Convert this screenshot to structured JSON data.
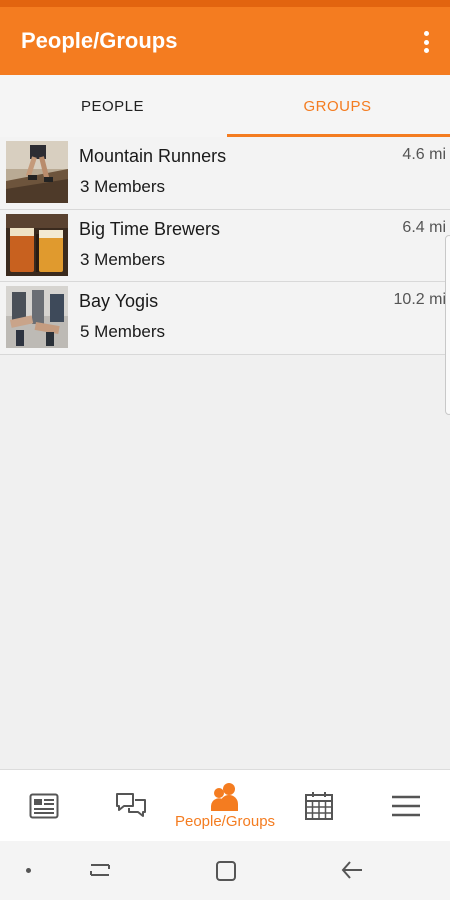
{
  "app_bar": {
    "title": "People/Groups",
    "menu_icon": "overflow-menu-icon"
  },
  "tabs": [
    {
      "label": "PEOPLE",
      "selected": false
    },
    {
      "label": "GROUPS",
      "selected": true
    }
  ],
  "groups": [
    {
      "name": "Mountain Runners",
      "members": "3 Members",
      "distance": "4.6 mi",
      "image": "runner-photo"
    },
    {
      "name": "Big Time Brewers",
      "members": "3 Members",
      "distance": "6.4 mi",
      "image": "beer-photo"
    },
    {
      "name": "Bay Yogis",
      "members": "5 Members",
      "distance": "10.2 mi",
      "image": "yoga-photo"
    }
  ],
  "bottom_nav": [
    {
      "icon": "news-icon",
      "label": ""
    },
    {
      "icon": "chat-icon",
      "label": ""
    },
    {
      "icon": "people-icon",
      "label": "People/Groups",
      "active": true
    },
    {
      "icon": "calendar-icon",
      "label": ""
    },
    {
      "icon": "menu-icon",
      "label": ""
    }
  ],
  "colors": {
    "accent": "#f47c20",
    "status_bar": "#e2640f",
    "background": "#f0f0f0"
  }
}
